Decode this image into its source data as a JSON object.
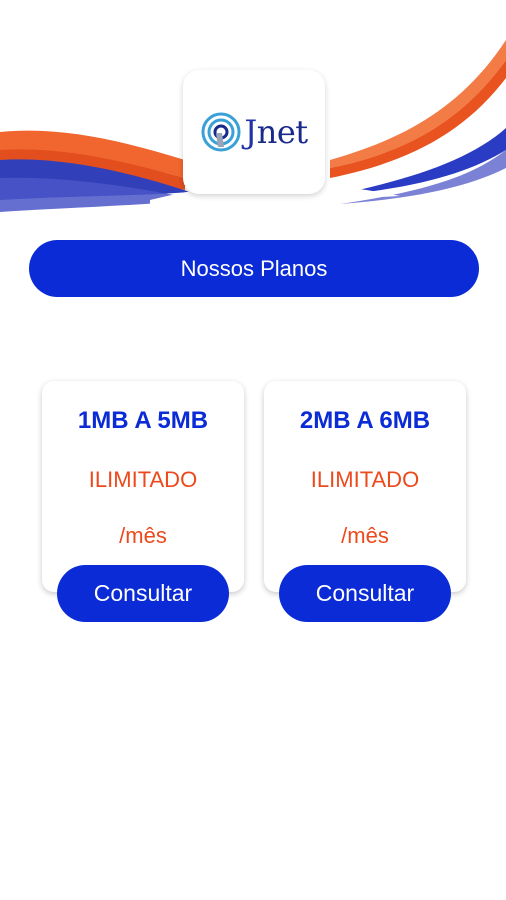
{
  "header": {
    "logo_text": "net",
    "logo_letter": "J",
    "colors": {
      "wave_orange": "#ef5a23",
      "wave_blue": "#2b3cc4",
      "logo_blue": "#1a2a8c"
    }
  },
  "section": {
    "title": "Nossos Planos"
  },
  "plans": [
    {
      "speed": "1MB A 5MB",
      "kind": "ILIMITADO",
      "period": "/mês",
      "button_label": "Consultar"
    },
    {
      "speed": "2MB A 6MB",
      "kind": "ILIMITADO",
      "period": "/mês",
      "button_label": "Consultar"
    }
  ],
  "theme": {
    "primary": "#0a2bd6",
    "accent": "#ec4a1c",
    "background": "#ffffff"
  }
}
